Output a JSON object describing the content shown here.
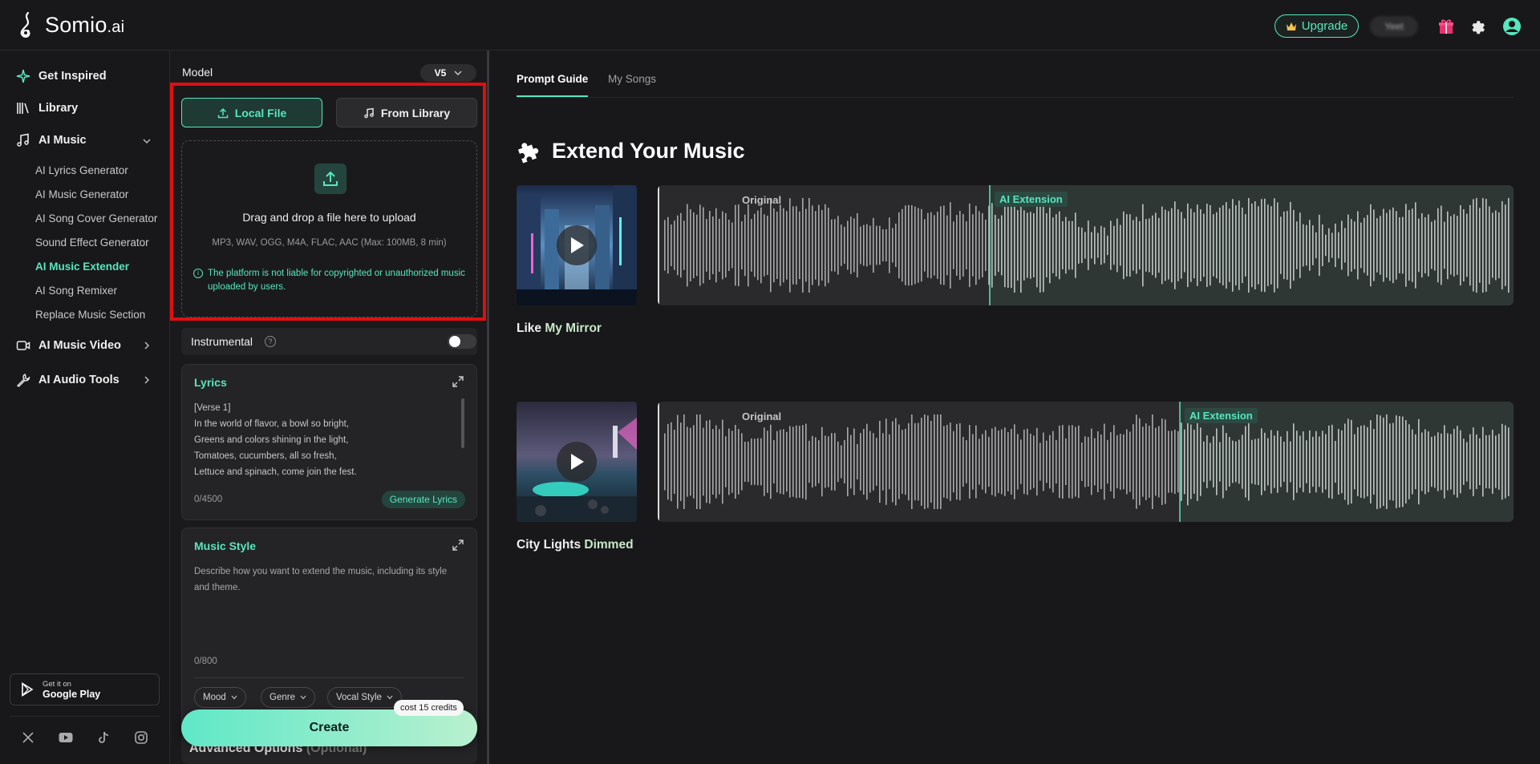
{
  "brand": {
    "name": "Somio",
    "suffix": ".ai"
  },
  "topbar": {
    "upgrade_label": "Upgrade",
    "credits_blurred": "Yeet"
  },
  "sidebar": {
    "get_inspired": "Get Inspired",
    "library": "Library",
    "ai_music": "AI Music",
    "ai_music_items": [
      "AI Lyrics Generator",
      "AI Music Generator",
      "AI Song Cover Generator",
      "Sound Effect Generator",
      "AI Music Extender",
      "AI Song Remixer",
      "Replace Music Section"
    ],
    "active_item": "AI Music Extender",
    "ai_music_video": "AI Music Video",
    "ai_audio_tools": "AI Audio Tools",
    "google_play_small": "Get it on",
    "google_play_big": "Google Play"
  },
  "panel": {
    "model_label": "Model",
    "model_value": "V5",
    "local_file": "Local File",
    "from_library": "From Library",
    "drop_title": "Drag and drop a file here to upload",
    "drop_formats": "MP3, WAV, OGG, M4A, FLAC, AAC (Max: 100MB, 8 min)",
    "drop_warning": "The platform is not liable for copyrighted or unauthorized music uploaded by users.",
    "instrumental": "Instrumental",
    "lyrics_title": "Lyrics",
    "lyrics_lines": [
      "[Verse 1]",
      "In the world of flavor, a bowl so bright,",
      "Greens and colors shining in the light,",
      "Tomatoes, cucumbers, all so fresh,",
      "Lettuce and spinach, come join the fest."
    ],
    "lyrics_counter": "0/4500",
    "generate_lyrics": "Generate Lyrics",
    "style_title": "Music Style",
    "style_placeholder": "Describe how you want to extend the music, including its style and theme.",
    "style_counter": "0/800",
    "chips": [
      "Mood",
      "Genre",
      "Vocal Style"
    ],
    "advanced": "Advanced Options",
    "advanced_optional": "(Optional)",
    "create": "Create",
    "cost": "cost 15 credits"
  },
  "main": {
    "tabs": [
      "Prompt Guide",
      "My Songs"
    ],
    "active_tab": "Prompt Guide",
    "heading": "Extend Your Music",
    "original_label": "Original",
    "extension_label": "AI Extension",
    "songs": [
      {
        "title_main": "Like ",
        "title_accent": "My Mirror",
        "split": 0.388
      },
      {
        "title_main": "City Lights ",
        "title_accent": "Dimmed",
        "split": 0.61
      }
    ]
  },
  "colors": {
    "accent": "#58e6be",
    "highlight": "#e00f0f",
    "bg": "#18181a"
  }
}
